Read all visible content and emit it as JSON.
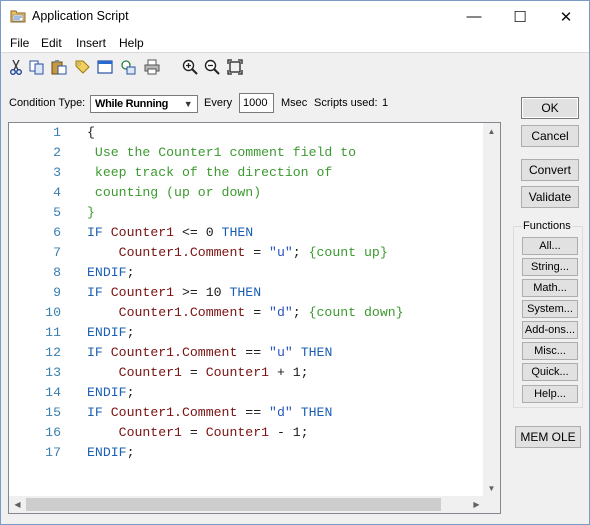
{
  "window": {
    "title": "Application Script",
    "controls": {
      "minimize": "—",
      "maximize": "☐",
      "close": "✕"
    }
  },
  "menu": [
    "File",
    "Edit",
    "Insert",
    "Help"
  ],
  "toolbar_icons": [
    "cut-icon",
    "copy-icon",
    "paste-icon",
    "tag-icon",
    "window-icon",
    "link-icon",
    "print-icon",
    "zoom-in-icon",
    "zoom-out-icon",
    "fit-icon"
  ],
  "condition": {
    "type_label": "Condition Type:",
    "type_value": "While Running",
    "every_label": "Every",
    "every_value": "1000",
    "msec_label": "Msec",
    "scripts_used_label": "Scripts used:",
    "scripts_used_value": "1"
  },
  "code": [
    {
      "n": "1",
      "t": [
        [
          "op",
          "{"
        ]
      ]
    },
    {
      "n": "2",
      "t": [
        [
          "cmt",
          " Use the Counter1 comment field to"
        ]
      ]
    },
    {
      "n": "3",
      "t": [
        [
          "cmt",
          " keep track of the direction of"
        ]
      ]
    },
    {
      "n": "4",
      "t": [
        [
          "cmt",
          " counting (up or down)"
        ]
      ]
    },
    {
      "n": "5",
      "t": [
        [
          "cmt",
          "}"
        ]
      ]
    },
    {
      "n": "6",
      "t": [
        [
          "kw",
          "IF "
        ],
        [
          "var",
          "Counter1"
        ],
        [
          "op",
          " <= 0 "
        ],
        [
          "kw",
          "THEN"
        ]
      ]
    },
    {
      "n": "7",
      "t": [
        [
          "op",
          "    "
        ],
        [
          "var",
          "Counter1.Comment"
        ],
        [
          "op",
          " = "
        ],
        [
          "str",
          "\"u\""
        ],
        [
          "op",
          "; "
        ],
        [
          "cmt",
          "{count up}"
        ]
      ]
    },
    {
      "n": "8",
      "t": [
        [
          "kw",
          "ENDIF"
        ],
        [
          "op",
          ";"
        ]
      ]
    },
    {
      "n": "9",
      "t": [
        [
          "kw",
          "IF "
        ],
        [
          "var",
          "Counter1"
        ],
        [
          "op",
          " >= 10 "
        ],
        [
          "kw",
          "THEN"
        ]
      ]
    },
    {
      "n": "10",
      "t": [
        [
          "op",
          "    "
        ],
        [
          "var",
          "Counter1.Comment"
        ],
        [
          "op",
          " = "
        ],
        [
          "str",
          "\"d\""
        ],
        [
          "op",
          "; "
        ],
        [
          "cmt",
          "{count down}"
        ]
      ]
    },
    {
      "n": "11",
      "t": [
        [
          "kw",
          "ENDIF"
        ],
        [
          "op",
          ";"
        ]
      ]
    },
    {
      "n": "12",
      "t": [
        [
          "kw",
          "IF "
        ],
        [
          "var",
          "Counter1.Comment"
        ],
        [
          "op",
          " == "
        ],
        [
          "str",
          "\"u\""
        ],
        [
          "op",
          " "
        ],
        [
          "kw",
          "THEN"
        ]
      ]
    },
    {
      "n": "13",
      "t": [
        [
          "op",
          "    "
        ],
        [
          "var",
          "Counter1"
        ],
        [
          "op",
          " = "
        ],
        [
          "var",
          "Counter1"
        ],
        [
          "op",
          " + 1;"
        ]
      ]
    },
    {
      "n": "14",
      "t": [
        [
          "kw",
          "ENDIF"
        ],
        [
          "op",
          ";"
        ]
      ]
    },
    {
      "n": "15",
      "t": [
        [
          "kw",
          "IF "
        ],
        [
          "var",
          "Counter1.Comment"
        ],
        [
          "op",
          " == "
        ],
        [
          "str",
          "\"d\""
        ],
        [
          "op",
          " "
        ],
        [
          "kw",
          "THEN"
        ]
      ]
    },
    {
      "n": "16",
      "t": [
        [
          "op",
          "    "
        ],
        [
          "var",
          "Counter1"
        ],
        [
          "op",
          " = "
        ],
        [
          "var",
          "Counter1"
        ],
        [
          "op",
          " - 1;"
        ]
      ]
    },
    {
      "n": "17",
      "t": [
        [
          "kw",
          "ENDIF"
        ],
        [
          "op",
          ";"
        ]
      ]
    }
  ],
  "buttons": {
    "ok": "OK",
    "cancel": "Cancel",
    "convert": "Convert",
    "validate": "Validate",
    "mem_ole": "MEM OLE"
  },
  "functions": {
    "label": "Functions",
    "items": [
      "All...",
      "String...",
      "Math...",
      "System...",
      "Add-ons...",
      "Misc...",
      "Quick...",
      "Help..."
    ]
  },
  "colors": {
    "keyword": "#1a5fb4",
    "variable": "#7a1212",
    "string": "#2a55c0",
    "comment": "#3c9a30",
    "line_number": "#3a7fb0"
  }
}
